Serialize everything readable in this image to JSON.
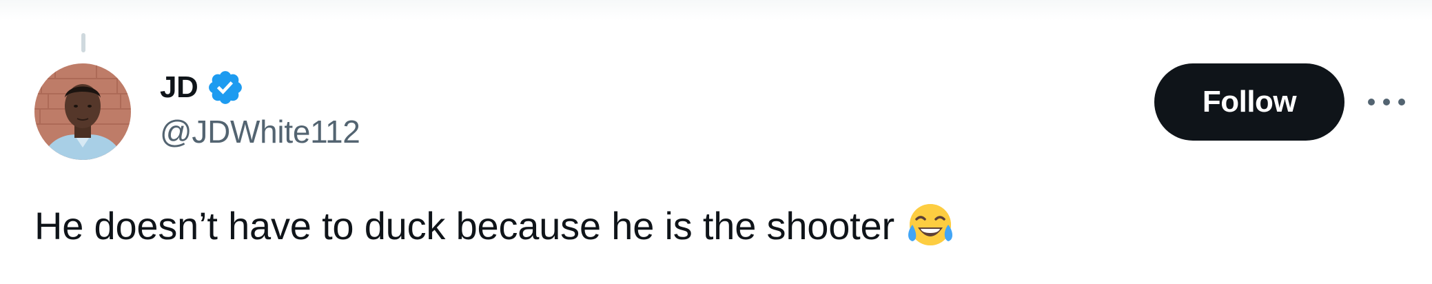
{
  "tweet": {
    "author": {
      "display_name": "JD",
      "handle": "@JDWhite112",
      "verified": true,
      "verified_color": "#1d9bf0"
    },
    "follow_label": "Follow",
    "more_icon": "more-horizontal-icon",
    "text": "He doesn’t have to duck because he is the shooter",
    "emoji": "face-with-tears-of-joy-icon"
  },
  "colors": {
    "text_primary": "#0f1419",
    "text_secondary": "#536471",
    "follow_bg": "#0f1419",
    "follow_text": "#ffffff",
    "verified_badge": "#1d9bf0"
  }
}
